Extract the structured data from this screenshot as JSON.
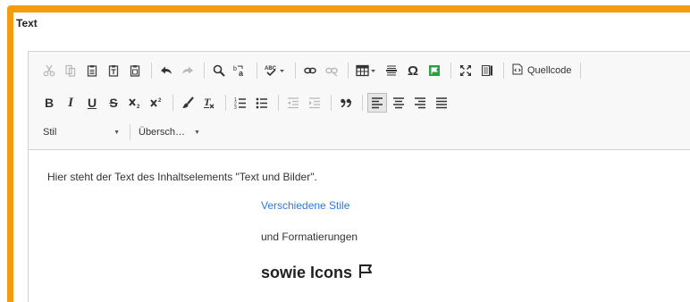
{
  "panel": {
    "title": "Text"
  },
  "toolbar": {
    "source_label": "Quellcode",
    "bold": "B",
    "italic": "I",
    "underline": "U",
    "strike": "S",
    "blockquote": "99",
    "omega": "Ω",
    "style_combo": "Stil",
    "heading_combo": "Übersch…"
  },
  "content": {
    "line1": "Hier steht der Text des Inhaltselements \"Text und Bilder\".",
    "line2": "Verschiedene Stile",
    "line3": "und Formatierungen",
    "line4": "sowie Icons"
  },
  "colors": {
    "frame": "#f39c12",
    "link": "#2a7ae2",
    "flag_green": "#2e9e44"
  }
}
